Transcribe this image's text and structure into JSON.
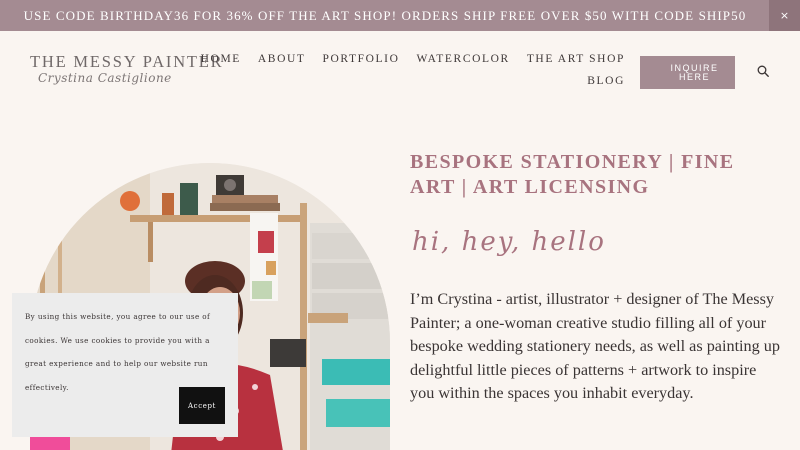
{
  "promo": {
    "text": "USE CODE BIRTHDAY36 FOR 36% OFF THE ART SHOP! ORDERS SHIP FREE OVER $50 WITH CODE SHIP50",
    "close_label": "×"
  },
  "logo": {
    "title": "THE MESSY PAINTER",
    "script": "Crystina Castiglione"
  },
  "nav": {
    "row1": [
      "HOME",
      "ABOUT",
      "PORTFOLIO",
      "WATERCOLOR",
      "THE ART SHOP"
    ],
    "row2": [
      "BLOG"
    ]
  },
  "inquire_label": "INQUIRE HERE",
  "hero": {
    "headline": "BESPOKE STATIONERY | FINE ART | ART LICENSING",
    "greeting": "hi, hey, hello",
    "intro": "I’m Crystina - artist, illustrator + designer of The Messy Painter; a one-woman creative studio filling all of your bespoke wedding stationery needs, as well as painting up delightful little pieces of patterns + artwork to inspire you within the spaces you inhabit everyday."
  },
  "cookie": {
    "text": "By using this website, you agree to our use of cookies. We use cookies to provide you with a great experience and to help our website run effectively.",
    "accept_label": "Accept"
  },
  "colors": {
    "accent": "#a48b92",
    "headline": "#a8737f",
    "background": "#faf5f1"
  },
  "icons": {
    "search": "search-icon",
    "close": "close-icon"
  }
}
